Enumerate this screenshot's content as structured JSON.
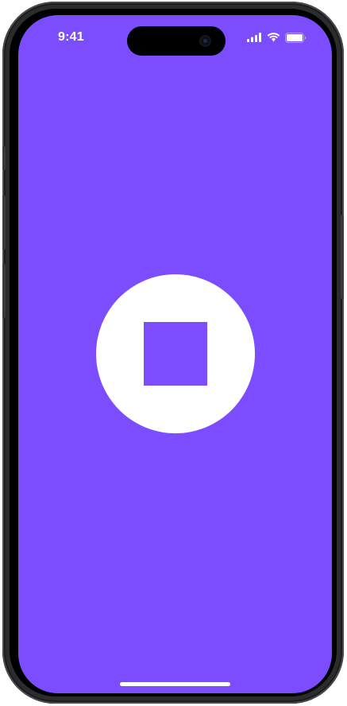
{
  "status_bar": {
    "time": "9:41",
    "icons": [
      "cellular-signal-icon",
      "wifi-icon",
      "battery-icon"
    ]
  },
  "main": {
    "control": {
      "icon": "stop-icon"
    }
  },
  "colors": {
    "background": "#7c4dff",
    "button": "#ffffff",
    "frame": "#2c2c2e"
  }
}
